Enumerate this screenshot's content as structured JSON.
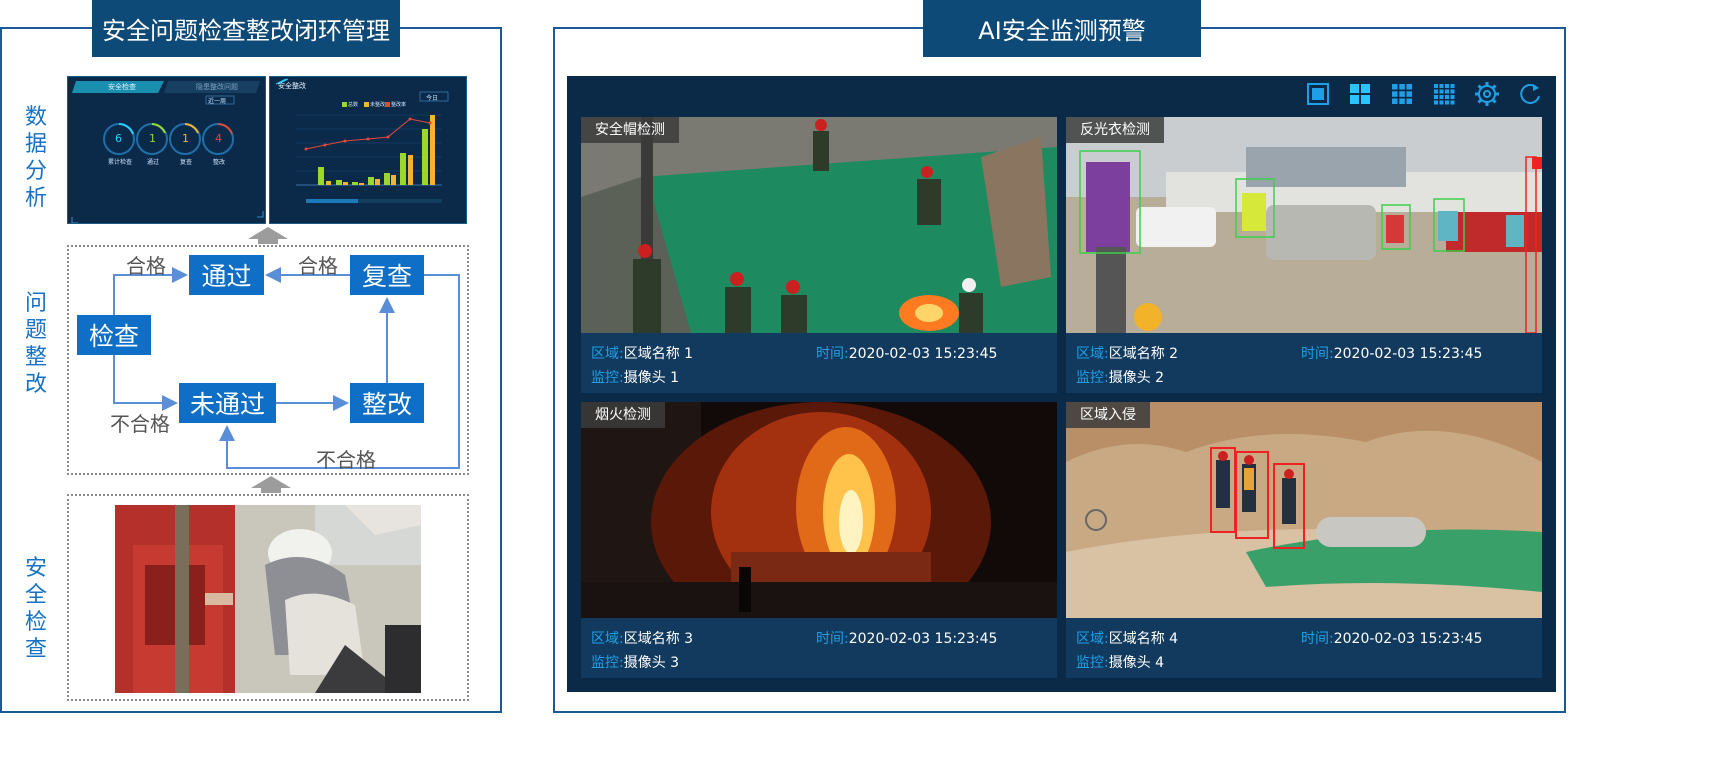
{
  "left": {
    "title": "安全问题检查整改闭环管理",
    "side_labels": [
      "数据分析",
      "问题整改",
      "安全检查"
    ],
    "dashboard": {
      "tabs": [
        "安全检查",
        "隐患整改问题"
      ],
      "filter": "近一周",
      "gauges": [
        {
          "value": "6",
          "label": "累计检查"
        },
        {
          "value": "1",
          "label": "通过"
        },
        {
          "value": "1",
          "label": "复查"
        },
        {
          "value": "4",
          "label": "整改"
        }
      ]
    },
    "chart_panel": {
      "title": "安全整改",
      "filter": "今日",
      "legend": [
        "总数",
        "未整改",
        "整改率"
      ]
    },
    "flow": {
      "check": "检查",
      "pass": "通过",
      "fail": "未通过",
      "recheck": "复查",
      "rectify": "整改",
      "qualified_1": "合格",
      "qualified_2": "合格",
      "unqualified_1": "不合格",
      "unqualified_2": "不合格"
    }
  },
  "right": {
    "title": "AI安全监测预警",
    "toolbar": [
      "single-view-icon",
      "quad-view-icon",
      "nine-view-icon",
      "sixteen-view-icon",
      "gear-icon",
      "refresh-icon"
    ],
    "area_key": "区域:",
    "time_key": "时间:",
    "camera_key": "监控:",
    "cells": [
      {
        "tag": "安全帽检测",
        "area": "区域名称 1",
        "time": "2020-02-03 15:23:45",
        "camera": "摄像头 1"
      },
      {
        "tag": "反光衣检测",
        "area": "区域名称 2",
        "time": "2020-02-03 15:23:45",
        "camera": "摄像头 2"
      },
      {
        "tag": "烟火检测",
        "area": "区域名称 3",
        "time": "2020-02-03 15:23:45",
        "camera": "摄像头 3"
      },
      {
        "tag": "区域入侵",
        "area": "区域名称 4",
        "time": "2020-02-03 15:23:45",
        "camera": "摄像头 4"
      }
    ]
  }
}
